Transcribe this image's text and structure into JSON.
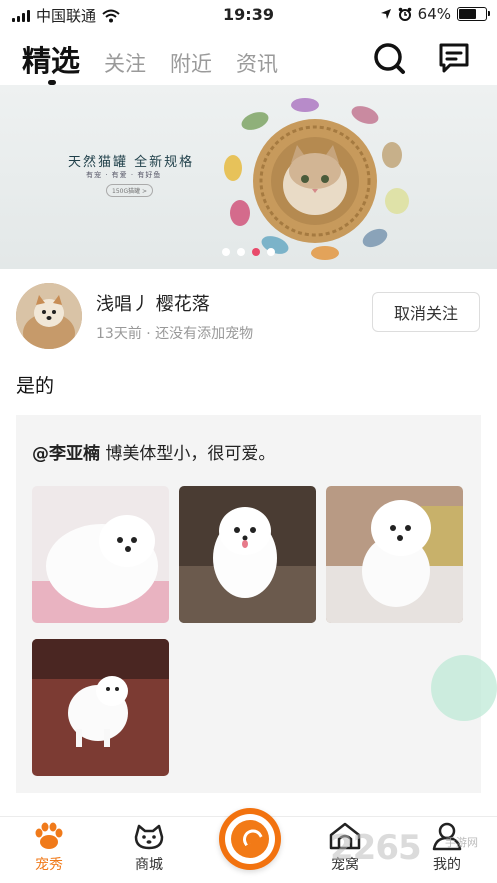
{
  "status_bar": {
    "carrier": "中国联通",
    "time": "19:39",
    "battery": "64%",
    "battery_level": 0.64
  },
  "top_tabs": [
    {
      "label": "精选",
      "active": true
    },
    {
      "label": "关注",
      "active": false
    },
    {
      "label": "附近",
      "active": false
    },
    {
      "label": "资讯",
      "active": false
    }
  ],
  "header_icons": [
    "search-icon",
    "message-icon"
  ],
  "banner": {
    "headline": "天然猫罐 全新规格",
    "sub": "有宠 · 有爱 · 有好鱼",
    "pill": "150G猫罐 >",
    "slides": 4,
    "active_slide": 3
  },
  "post": {
    "username": "浅唱丿 樱花落",
    "meta": "13天前 · 还没有添加宠物",
    "follow_button": "取消关注",
    "text": "是的",
    "quote": {
      "mention": "@李亚楠",
      "text": " 博美体型小，很可爱。"
    },
    "photo_count": 4
  },
  "bottom_nav": [
    {
      "label": "宠秀",
      "icon": "paw-icon",
      "active": true
    },
    {
      "label": "商城",
      "icon": "dog-face-icon",
      "active": false
    },
    {
      "label": "",
      "icon": "camera-center-icon",
      "active": false
    },
    {
      "label": "宠窝",
      "icon": "pet-house-icon",
      "active": false
    },
    {
      "label": "我的",
      "icon": "user-icon",
      "active": false
    }
  ],
  "watermark": {
    "big": "2265",
    "small": "手游网"
  },
  "colors": {
    "accent": "#f07a1a",
    "active_dot": "#e84a6a",
    "quote_bg": "#f4f4f4"
  }
}
